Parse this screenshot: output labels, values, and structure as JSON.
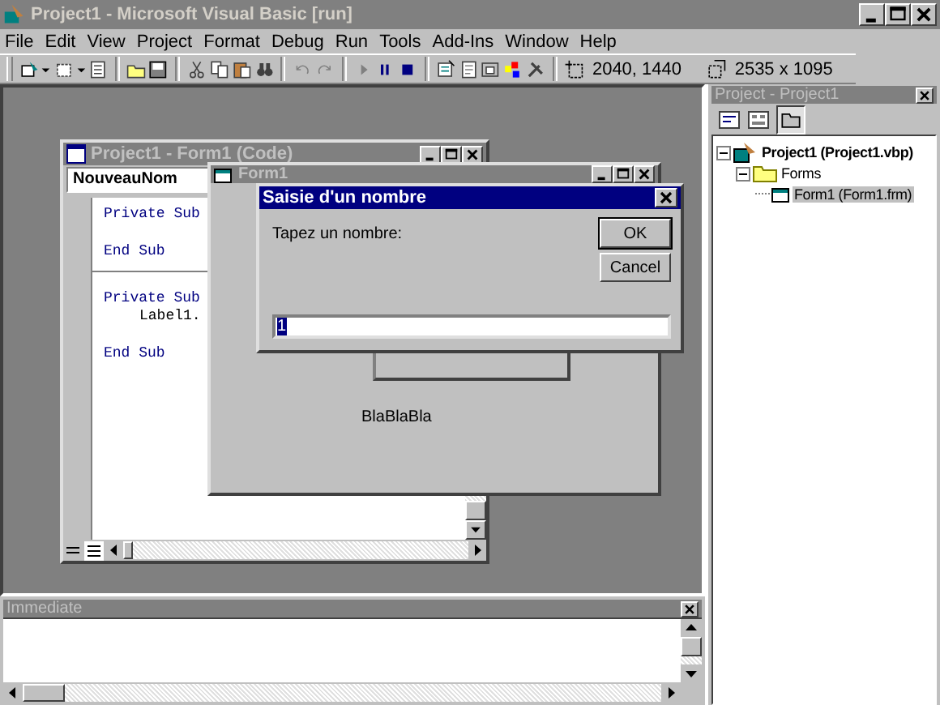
{
  "window": {
    "title": "Project1 - Microsoft Visual Basic [run]"
  },
  "menu": [
    "File",
    "Edit",
    "View",
    "Project",
    "Format",
    "Debug",
    "Run",
    "Tools",
    "Add-Ins",
    "Window",
    "Help"
  ],
  "toolbar": {
    "position": "2040, 1440",
    "size": "2535 x 1095"
  },
  "code_window": {
    "title": "Project1 - Form1 (Code)",
    "object": "NouveauNom",
    "procedures": [
      {
        "lines": [
          {
            "kind": "keyword",
            "text": "Private Sub"
          },
          {
            "kind": "blank"
          },
          {
            "kind": "keyword",
            "text": "End Sub"
          }
        ]
      },
      {
        "lines": [
          {
            "kind": "keyword",
            "text": "Private Sub"
          },
          {
            "kind": "statement",
            "text": "Label1."
          },
          {
            "kind": "blank"
          },
          {
            "kind": "keyword",
            "text": "End Sub"
          }
        ]
      }
    ]
  },
  "form": {
    "title": "Form1",
    "label": "BlaBlaBla"
  },
  "dialog": {
    "title": "Saisie d'un nombre",
    "prompt": "Tapez un nombre:",
    "buttons": [
      "OK",
      "Cancel"
    ],
    "value": "1"
  },
  "project": {
    "title": "Project - Project1",
    "tree": [
      {
        "label": "Project1 (Project1.vbp)",
        "kind": "project",
        "expanded": true,
        "selected": false,
        "children": [
          {
            "label": "Forms",
            "kind": "folder",
            "expanded": true,
            "selected": false,
            "children": [
              {
                "label": "Form1 (Form1.frm)",
                "kind": "form",
                "selected": true
              }
            ]
          }
        ]
      }
    ]
  },
  "immediate": {
    "title": "Immediate"
  }
}
